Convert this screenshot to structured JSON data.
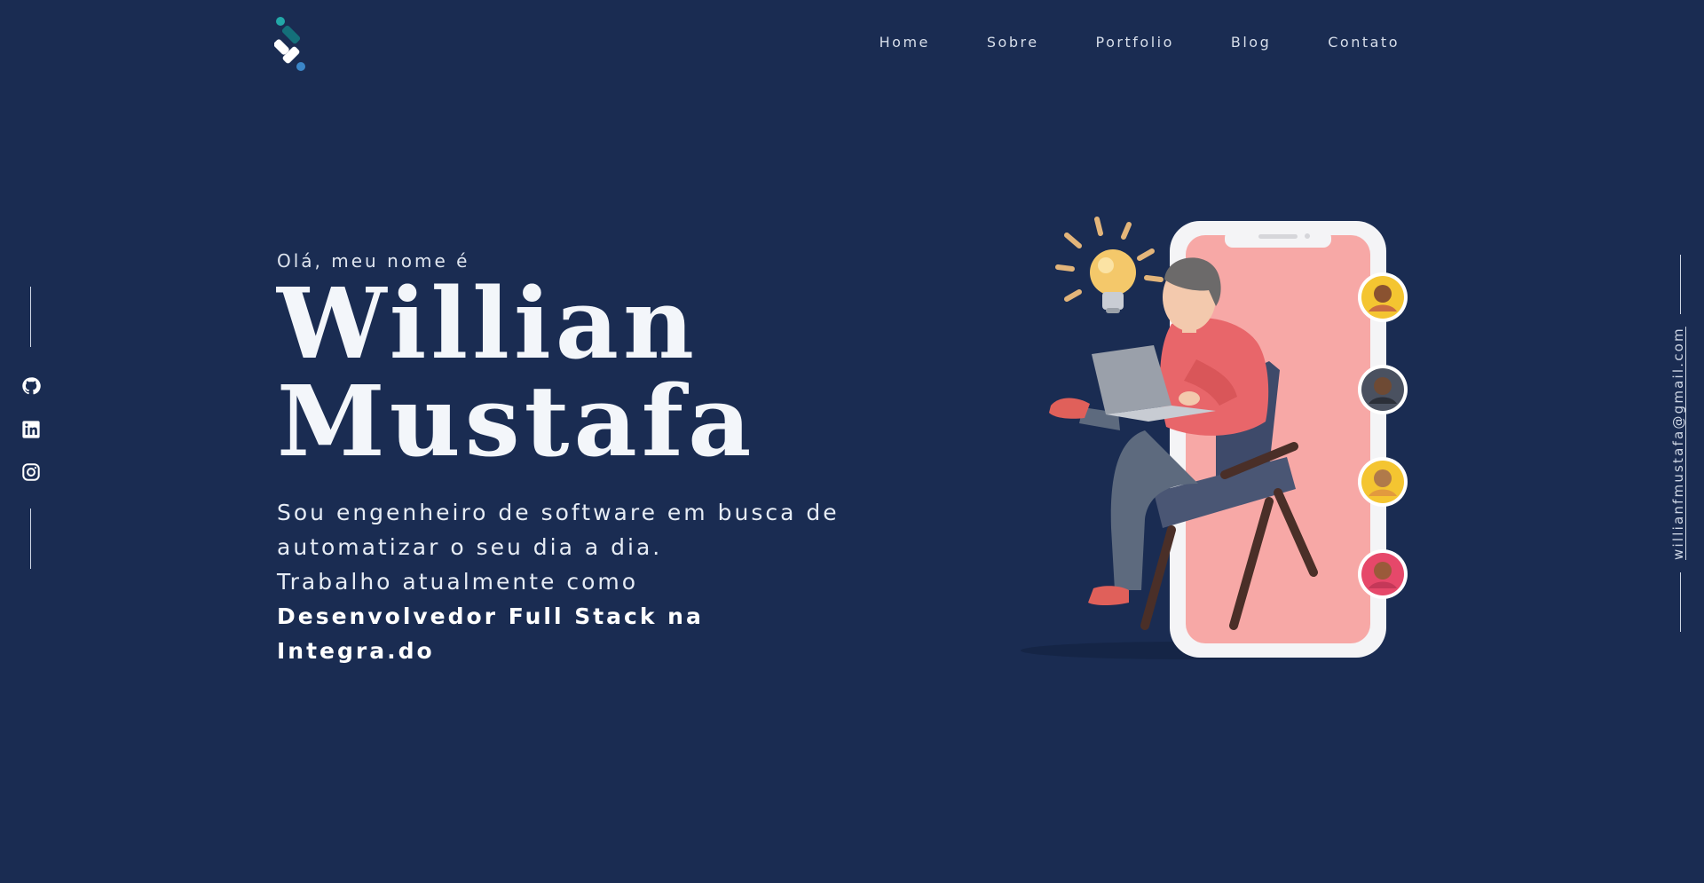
{
  "header": {
    "nav": [
      "Home",
      "Sobre",
      "Portfolio",
      "Blog",
      "Contato"
    ]
  },
  "social": [
    "github-icon",
    "linkedin-icon",
    "instagram-icon"
  ],
  "email": "willianfmustafa@gmail.com",
  "hero": {
    "greeting": "Olá, meu nome é",
    "first_name": "Willian",
    "last_name": "Mustafa",
    "bio_line1": "Sou engenheiro de software em busca de automatizar o seu dia a dia.",
    "bio_line2_prefix": "Trabalho atualmente como ",
    "bio_line2_bold": "Desenvolvedor Full Stack na Integra.do"
  },
  "colors": {
    "background": "#1a2c52",
    "text": "#e6ecf5",
    "phone_screen": "#f7a8a6",
    "accent_teal": "#1aa2a8"
  }
}
